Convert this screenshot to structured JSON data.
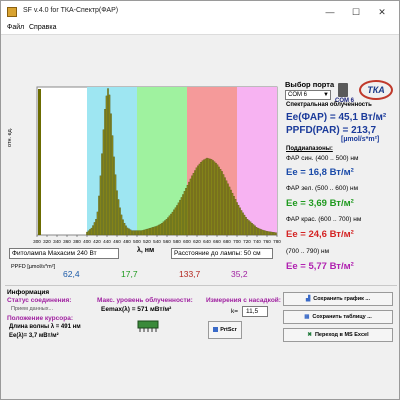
{
  "window": {
    "title": "SF v.4.0 for ТКА-Спектр(ФАР)",
    "min": "—",
    "max": "☐",
    "close": "✕"
  },
  "menu": {
    "file": "Файл",
    "help": "Справка"
  },
  "chart": {
    "ylabel": "отн. ед.",
    "lambda": "λ, нм"
  },
  "chart_data": {
    "type": "bar",
    "xlabel": "λ, нм",
    "ylabel": "отн. ед.",
    "xlim": [
      300,
      780
    ],
    "ylim": [
      0,
      1
    ],
    "x_ticks": [
      300,
      320,
      340,
      360,
      380,
      400,
      420,
      440,
      460,
      480,
      500,
      520,
      540,
      560,
      580,
      600,
      620,
      640,
      660,
      680,
      700,
      720,
      740,
      760,
      780
    ],
    "bands": [
      {
        "from": 400,
        "to": 500,
        "color": "#9ee6f2"
      },
      {
        "from": 500,
        "to": 600,
        "color": "#9ff29f"
      },
      {
        "from": 600,
        "to": 700,
        "color": "#f59a9a"
      },
      {
        "from": 700,
        "to": 780,
        "color": "#f7b3f2"
      }
    ],
    "spectrum": [
      [
        400,
        0.02
      ],
      [
        410,
        0.05
      ],
      [
        420,
        0.12
      ],
      [
        425,
        0.3
      ],
      [
        430,
        0.55
      ],
      [
        435,
        0.82
      ],
      [
        440,
        0.97
      ],
      [
        443,
        1.0
      ],
      [
        446,
        0.92
      ],
      [
        450,
        0.72
      ],
      [
        455,
        0.48
      ],
      [
        460,
        0.3
      ],
      [
        465,
        0.2
      ],
      [
        470,
        0.12
      ],
      [
        475,
        0.08
      ],
      [
        480,
        0.05
      ],
      [
        490,
        0.03
      ],
      [
        500,
        0.03
      ],
      [
        510,
        0.03
      ],
      [
        520,
        0.04
      ],
      [
        530,
        0.05
      ],
      [
        540,
        0.06
      ],
      [
        550,
        0.08
      ],
      [
        560,
        0.11
      ],
      [
        570,
        0.15
      ],
      [
        580,
        0.2
      ],
      [
        590,
        0.26
      ],
      [
        600,
        0.33
      ],
      [
        610,
        0.4
      ],
      [
        620,
        0.46
      ],
      [
        630,
        0.5
      ],
      [
        640,
        0.52
      ],
      [
        650,
        0.51
      ],
      [
        660,
        0.48
      ],
      [
        670,
        0.43
      ],
      [
        680,
        0.36
      ],
      [
        690,
        0.29
      ],
      [
        700,
        0.22
      ],
      [
        710,
        0.16
      ],
      [
        720,
        0.11
      ],
      [
        730,
        0.08
      ],
      [
        740,
        0.05
      ],
      [
        750,
        0.035
      ],
      [
        760,
        0.025
      ],
      [
        770,
        0.02
      ],
      [
        780,
        0.015
      ]
    ]
  },
  "inputs": {
    "lamp_name": "Фитолампа Махасим 240 Вт",
    "distance": "Расстояние до лампы: 50 см"
  },
  "ppfd": {
    "label": "PPFD [µmol/s*m²]",
    "blue": "62,4",
    "green": "17,7",
    "red": "133,7",
    "far_red": "35,2"
  },
  "port": {
    "label": "Выбор порта",
    "value": "COM 6",
    "com_label": "COM 6"
  },
  "logo": {
    "text": "ТКА"
  },
  "results": {
    "title": "Спектральная облученность",
    "ee_far": "Ee(ФАР) = 45,1 Вт/м²",
    "ppfd_par": "PPFD(PAR) = 213,7",
    "ppfd_unit": "[µmol/s*m²]",
    "subbands_title": "Поддиапазоны:",
    "blue_label": "ФАР син. (400 .. 500) нм",
    "blue_ee": "Ee = 16,8 Вт/м²",
    "green_label": "ФАР зел. (500 .. 600) нм",
    "green_ee": "Ee = 3,69 Вт/м²",
    "red_label": "ФАР крас. (600 .. 700) нм",
    "red_ee": "Ee = 24,6 Вт/м²",
    "far_red_label": "(700 .. 790) нм",
    "far_red_ee": "Ee = 5,77 Вт/м²"
  },
  "info": {
    "header": "Информация",
    "status_label": "Статус соединения:",
    "status_value": "Прием данных...",
    "cursor_label": "Положение курсора:",
    "wavelength": "Длина волны λ = 491 нм",
    "ee_at": "Ee(λ)= 3,7 мВт/м²",
    "max_label": "Макс. уровень облученности:",
    "max_value": "Eemax(λ) = 571 мВт/м²",
    "meas_label": "Измерения с насадкой:",
    "k_label": "k=",
    "k_value": "11,5",
    "prtscr": "PrtScr",
    "save_chart": "Сохранить график ...",
    "save_table": "Сохранить таблицу ...",
    "to_excel": "Переход в MS Excel"
  }
}
